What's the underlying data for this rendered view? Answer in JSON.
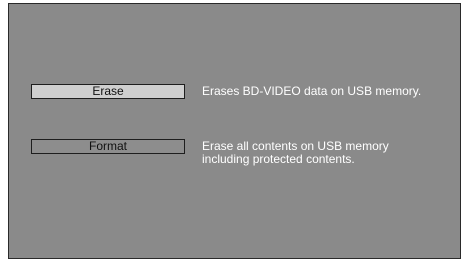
{
  "menu": {
    "items": [
      {
        "label": "Erase",
        "description_lines": [
          "Erases BD-VIDEO data on USB memory."
        ],
        "selected": true
      },
      {
        "label": "Format",
        "description_lines": [
          "Erase all contents on USB memory",
          "including protected contents."
        ],
        "selected": false
      }
    ]
  },
  "colors": {
    "screen_background": "#8a8a8a",
    "selected_button": "#cfcfcf",
    "description_text": "#ffffff"
  }
}
